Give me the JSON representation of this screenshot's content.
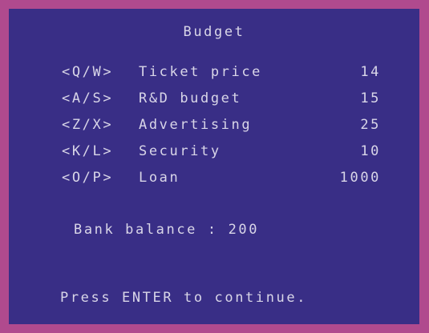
{
  "screen": {
    "title": "Budget",
    "rows": [
      {
        "keys": "<Q/W>",
        "label": "Ticket price",
        "value": "14"
      },
      {
        "keys": "<A/S>",
        "label": "R&D budget",
        "value": "15"
      },
      {
        "keys": "<Z/X>",
        "label": "Advertising",
        "value": "25"
      },
      {
        "keys": "<K/L>",
        "label": "Security",
        "value": "10"
      },
      {
        "keys": "<O/P>",
        "label": "Loan",
        "value": "1000"
      }
    ],
    "balance_label": "Bank balance",
    "balance_separator": ":",
    "balance_value": "200",
    "prompt": "Press ENTER to continue."
  },
  "colors": {
    "border": "#b04a8e",
    "background": "#392e86",
    "text": "#d9d6e8"
  }
}
